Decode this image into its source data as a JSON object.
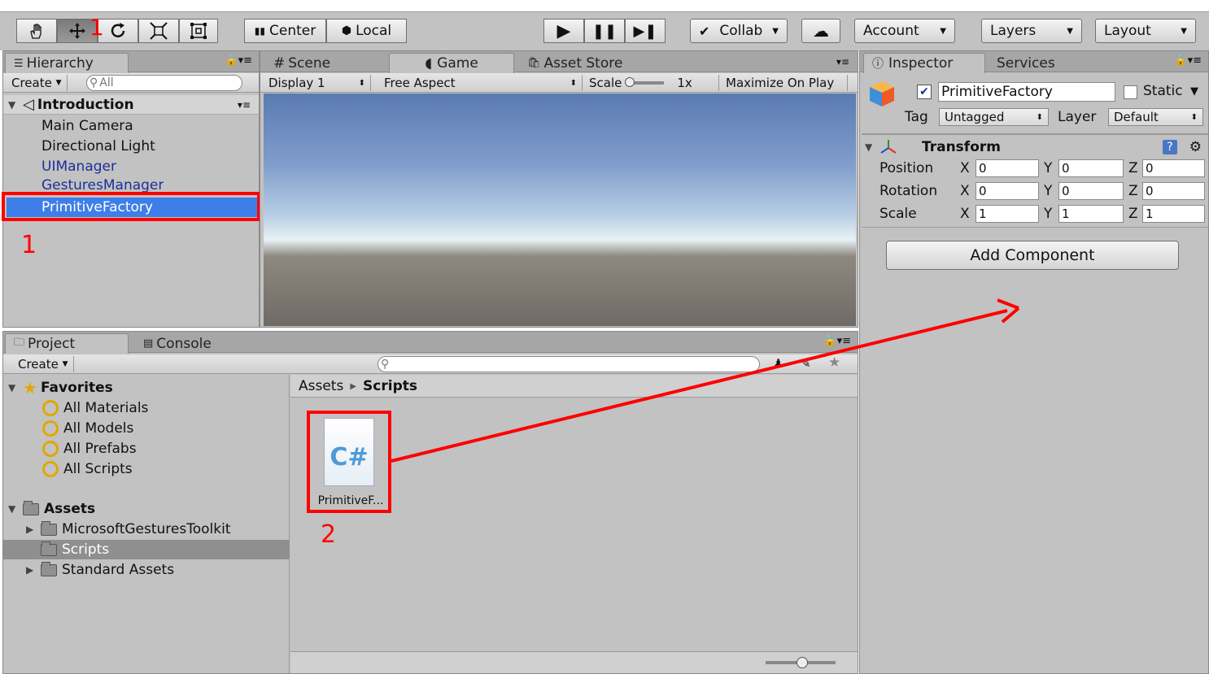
{
  "toolbar": {
    "hand_icon": "hand-icon",
    "move_icon": "move-icon",
    "rotate_icon": "rotate-icon",
    "scale_icon": "scale-icon",
    "rect_icon": "rect-icon",
    "annotation_1": "1",
    "center_label": "Center",
    "local_label": "Local",
    "play_icon": "▶",
    "pause_icon": "❚❚",
    "step_icon": "▶❚",
    "collab_label": "Collab",
    "cloud_icon": "☁",
    "account_label": "Account",
    "layers_label": "Layers",
    "layout_label": "Layout"
  },
  "hierarchy": {
    "tab_label": "Hierarchy",
    "create_label": "Create",
    "search_placeholder": "All",
    "scene_name": "Introduction",
    "items": [
      {
        "label": "Main Camera"
      },
      {
        "label": "Directional Light"
      },
      {
        "label": "UIManager"
      },
      {
        "label": "GesturesManager"
      },
      {
        "label": "PrimitiveFactory"
      }
    ],
    "annotation": "1"
  },
  "scene_tabs": {
    "scene_label": "Scene",
    "game_label": "Game",
    "asset_store_label": "Asset Store"
  },
  "game_bar": {
    "display_label": "Display 1",
    "aspect_label": "Free Aspect",
    "scale_label": "Scale",
    "scale_value": "1x",
    "maximize_label": "Maximize On Play"
  },
  "inspector": {
    "tab_label": "Inspector",
    "services_label": "Services",
    "object_name": "PrimitiveFactory",
    "static_label": "Static",
    "tag_label": "Tag",
    "tag_value": "Untagged",
    "layer_label": "Layer",
    "layer_value": "Default",
    "transform_label": "Transform",
    "position_label": "Position",
    "rotation_label": "Rotation",
    "scale_label": "Scale",
    "position": {
      "x": "0",
      "y": "0",
      "z": "0"
    },
    "rotation": {
      "x": "0",
      "y": "0",
      "z": "0"
    },
    "scale": {
      "x": "1",
      "y": "1",
      "z": "1"
    },
    "axis_x": "X",
    "axis_y": "Y",
    "axis_z": "Z",
    "add_component_label": "Add Component"
  },
  "project": {
    "tab_label": "Project",
    "console_label": "Console",
    "create_label": "Create",
    "favorites_label": "Favorites",
    "favorites": [
      {
        "label": "All Materials"
      },
      {
        "label": "All Models"
      },
      {
        "label": "All Prefabs"
      },
      {
        "label": "All Scripts"
      }
    ],
    "assets_label": "Assets",
    "asset_folders": [
      {
        "label": "MicrosoftGesturesToolkit"
      },
      {
        "label": "Scripts"
      },
      {
        "label": "Standard Assets"
      }
    ],
    "breadcrumb_root": "Assets",
    "breadcrumb_current": "Scripts",
    "file_glyph": "C#",
    "file_label": "PrimitiveF...",
    "annotation": "2"
  },
  "colors": {
    "selection_blue": "#3e7ee8",
    "annotation_red": "#ff0000",
    "panel_gray": "#c2c2c2"
  }
}
